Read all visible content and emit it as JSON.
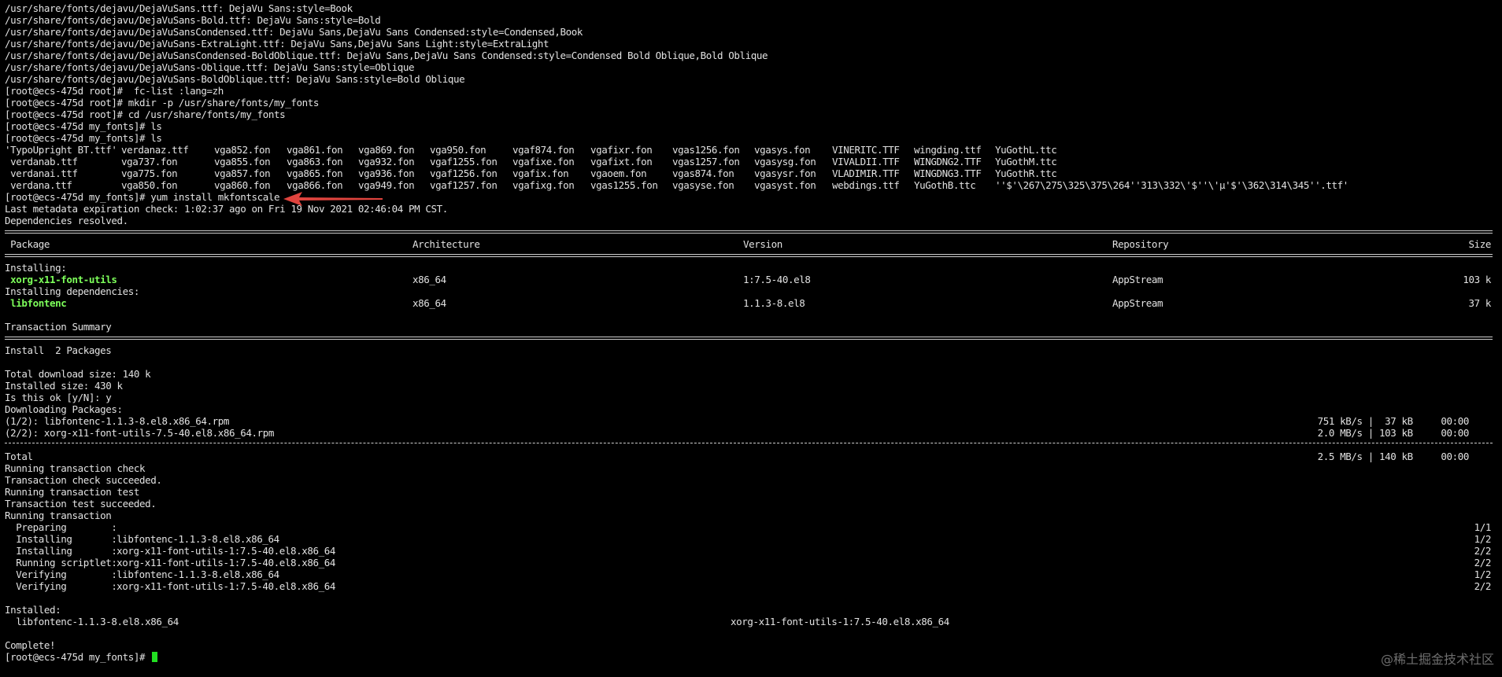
{
  "terminal": {
    "font_list": [
      "/usr/share/fonts/dejavu/DejaVuSans.ttf: DejaVu Sans:style=Book",
      "/usr/share/fonts/dejavu/DejaVuSans-Bold.ttf: DejaVu Sans:style=Bold",
      "/usr/share/fonts/dejavu/DejaVuSansCondensed.ttf: DejaVu Sans,DejaVu Sans Condensed:style=Condensed,Book",
      "/usr/share/fonts/dejavu/DejaVuSans-ExtraLight.ttf: DejaVu Sans,DejaVu Sans Light:style=ExtraLight",
      "/usr/share/fonts/dejavu/DejaVuSansCondensed-BoldOblique.ttf: DejaVu Sans,DejaVu Sans Condensed:style=Condensed Bold Oblique,Bold Oblique",
      "/usr/share/fonts/dejavu/DejaVuSans-Oblique.ttf: DejaVu Sans:style=Oblique",
      "/usr/share/fonts/dejavu/DejaVuSans-BoldOblique.ttf: DejaVu Sans:style=Bold Oblique"
    ],
    "commands": [
      "[root@ecs-475d root]#  fc-list :lang=zh",
      "[root@ecs-475d root]# mkdir -p /usr/share/fonts/my_fonts",
      "[root@ecs-475d root]# cd /usr/share/fonts/my_fonts",
      "[root@ecs-475d my_fonts]# ls",
      "[root@ecs-475d my_fonts]# ls"
    ],
    "ls_rows": [
      [
        "'TypoUpright BT.ttf'",
        "verdanaz.ttf",
        "vga852.fon",
        "vga861.fon",
        "vga869.fon",
        "vga950.fon",
        "vgaf874.fon",
        "vgafixr.fon",
        "vgas1256.fon",
        "vgasys.fon",
        "VINERITC.TTF",
        "wingding.ttf",
        "YuGothL.ttc",
        ""
      ],
      [
        " verdanab.ttf",
        "vga737.fon",
        "vga855.fon",
        "vga863.fon",
        "vga932.fon",
        "vgaf1255.fon",
        "vgafixe.fon",
        "vgafixt.fon",
        "vgas1257.fon",
        "vgasysg.fon",
        "VIVALDII.TTF",
        "WINGDNG2.TTF",
        "YuGothM.ttc",
        ""
      ],
      [
        " verdanai.ttf",
        "vga775.fon",
        "vga857.fon",
        "vga865.fon",
        "vga936.fon",
        "vgaf1256.fon",
        "vgafix.fon",
        "vgaoem.fon",
        "vgas874.fon",
        "vgasysr.fon",
        "VLADIMIR.TTF",
        "WINGDNG3.TTF",
        "YuGothR.ttc",
        ""
      ],
      [
        " verdana.ttf",
        "vga850.fon",
        "vga860.fon",
        "vga866.fon",
        "vga949.fon",
        "vgaf1257.fon",
        "vgafixg.fon",
        "vgas1255.fon",
        "vgasyse.fon",
        "vgasyst.fon",
        "webdings.ttf",
        "YuGothB.ttc",
        "''$'\\267\\275\\325\\375\\264''313\\332\\'$''\\'µ'$'\\362\\314\\345''.ttf'",
        ""
      ]
    ],
    "yum_command": "[root@ecs-475d my_fonts]# yum install mkfontscale",
    "metadata_line": "Last metadata expiration check: 1:02:37 ago on Fri 19 Nov 2021 02:46:04 PM CST.",
    "deps_resolved": "Dependencies resolved.",
    "table_headers": {
      "package": " Package",
      "architecture": "Architecture",
      "version": "Version",
      "repository": "Repository",
      "size": "Size"
    },
    "installing_label": "Installing:",
    "installing_deps_label": "Installing dependencies:",
    "packages": [
      {
        "name": " xorg-x11-font-utils",
        "arch": "x86_64",
        "version": "1:7.5-40.el8",
        "repo": "AppStream",
        "size": "103 k"
      },
      {
        "name": " libfontenc",
        "arch": "x86_64",
        "version": "1.1.3-8.el8",
        "repo": "AppStream",
        "size": "37 k"
      }
    ],
    "transaction_summary": "Transaction Summary",
    "install_count": "Install  2 Packages",
    "total_download": "Total download size: 140 k",
    "installed_size": "Installed size: 430 k",
    "confirm_prompt": "Is this ok [y/N]: y",
    "downloading": "Downloading Packages:",
    "downloads": [
      {
        "name": "(1/2): libfontenc-1.1.3-8.el8.x86_64.rpm",
        "rate": "751 kB/s |  37 kB     00:00"
      },
      {
        "name": "(2/2): xorg-x11-font-utils-7.5-40.el8.x86_64.rpm",
        "rate": "2.0 MB/s | 103 kB     00:00"
      }
    ],
    "total_label": "Total",
    "total_rate": "2.5 MB/s | 140 kB     00:00",
    "transaction_lines": [
      "Running transaction check",
      "Transaction check succeeded.",
      "Running transaction test",
      "Transaction test succeeded.",
      "Running transaction"
    ],
    "steps": [
      {
        "label": "  Preparing        :",
        "pkg": "",
        "count": "1/1"
      },
      {
        "label": "  Installing       :",
        "pkg": " libfontenc-1.1.3-8.el8.x86_64",
        "count": "1/2"
      },
      {
        "label": "  Installing       :",
        "pkg": " xorg-x11-font-utils-1:7.5-40.el8.x86_64",
        "count": "2/2"
      },
      {
        "label": "  Running scriptlet:",
        "pkg": " xorg-x11-font-utils-1:7.5-40.el8.x86_64",
        "count": "2/2"
      },
      {
        "label": "  Verifying        :",
        "pkg": " libfontenc-1.1.3-8.el8.x86_64",
        "count": "1/2"
      },
      {
        "label": "  Verifying        :",
        "pkg": " xorg-x11-font-utils-1:7.5-40.el8.x86_64",
        "count": "2/2"
      }
    ],
    "installed_label": "Installed:",
    "installed_pkgs": [
      "  libfontenc-1.1.3-8.el8.x86_64",
      "xorg-x11-font-utils-1:7.5-40.el8.x86_64"
    ],
    "complete": "Complete!",
    "final_prompt": "[root@ecs-475d my_fonts]# "
  },
  "colors": {
    "background": "#000000",
    "text": "#e2e2e2",
    "package_highlight": "#7dff5a",
    "cursor": "#22e022",
    "annotation_arrow": "#e0443e"
  },
  "watermark": "@稀土掘金技术社区"
}
